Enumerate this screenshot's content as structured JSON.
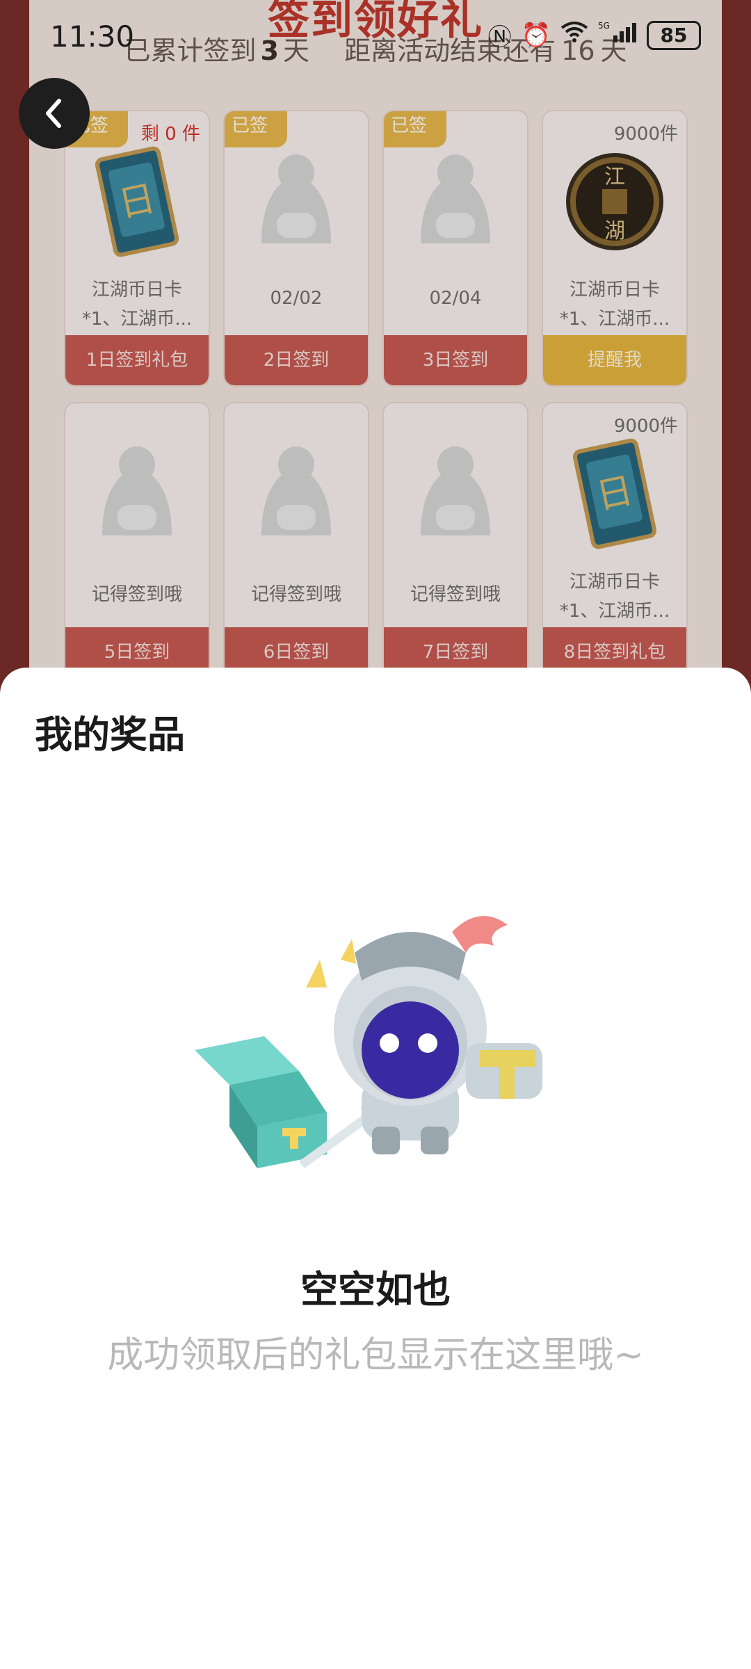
{
  "status": {
    "time": "11:30",
    "battery": "85",
    "icons": [
      "nfc-icon",
      "alarm-icon",
      "wifi-icon",
      "5g-signal-icon",
      "battery-icon"
    ]
  },
  "activity": {
    "title_fragment": "签到领好礼",
    "summary_prefix": "已累计签到",
    "summary_days": "3",
    "summary_unit": "天",
    "summary_remaining_prefix": "距离活动结束还有",
    "summary_remaining_days": "16",
    "summary_remaining_unit": "天"
  },
  "cards": [
    {
      "badge": "剩 0 件",
      "ribbon": "已签",
      "name_line1": "江湖币日卡",
      "name_line2": "*1、江湖币...",
      "action": "1日签到礼包",
      "art": "day-card-icon"
    },
    {
      "badge": "",
      "ribbon": "已签",
      "label": "02/02",
      "action": "2日签到",
      "art": "placeholder-mascot-icon"
    },
    {
      "badge": "",
      "ribbon": "已签",
      "label": "02/04",
      "action": "3日签到",
      "art": "placeholder-mascot-icon"
    },
    {
      "badge": "9000件",
      "ribbon": "",
      "name_line1": "江湖币日卡",
      "name_line2": "*1、江湖币...",
      "action": "提醒我",
      "art": "jianghu-coin-icon"
    },
    {
      "badge": "",
      "ribbon": "",
      "label": "记得签到哦",
      "action": "5日签到",
      "art": "placeholder-mascot-icon"
    },
    {
      "badge": "",
      "ribbon": "",
      "label": "记得签到哦",
      "action": "6日签到",
      "art": "placeholder-mascot-icon"
    },
    {
      "badge": "",
      "ribbon": "",
      "label": "记得签到哦",
      "action": "7日签到",
      "art": "placeholder-mascot-icon"
    },
    {
      "badge": "9000件",
      "ribbon": "",
      "name_line1": "江湖币日卡",
      "name_line2": "*1、江湖币...",
      "action": "8日签到礼包",
      "art": "day-card-icon"
    }
  ],
  "sheet": {
    "title": "我的奖品",
    "empty_title": "空空如也",
    "empty_desc": "成功领取后的礼包显示在这里哦~"
  }
}
